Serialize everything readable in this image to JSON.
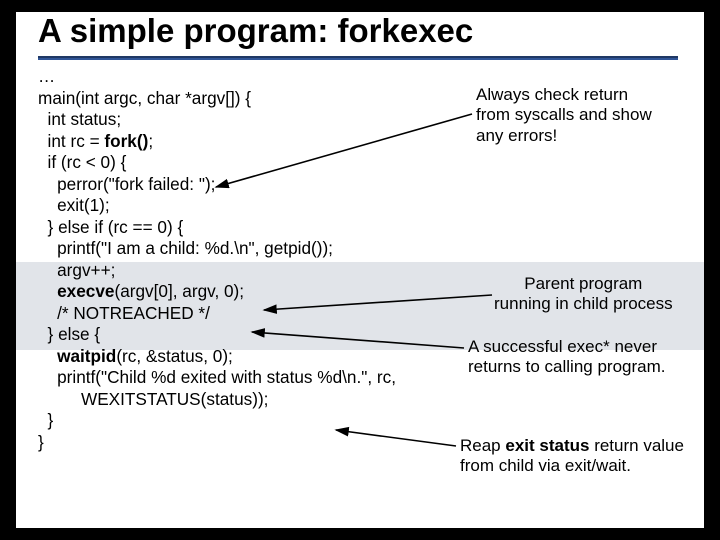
{
  "title": "A simple program: forkexec",
  "code": {
    "l0": "…",
    "l1a": "main(int argc, char *argv[]) {",
    "l2": "  int status;",
    "l3a": "  int rc = ",
    "l3b": "fork()",
    "l3c": ";",
    "l4": "  if (rc < 0) {",
    "l5": "    perror(\"fork failed: \");",
    "l6": "    exit(1);",
    "l7": "  } else if (rc == 0) {",
    "l8": "    printf(\"I am a child: %d.\\n\", getpid());",
    "l9": "    argv++;",
    "l10a": "    ",
    "l10b": "execve",
    "l10c": "(argv[0], argv, 0);",
    "l11": "    /* NOTREACHED */",
    "l12": "  } else {",
    "l13a": "    ",
    "l13b": "waitpid",
    "l13c": "(rc, &status, 0);",
    "l14": "    printf(\"Child %d exited with status %d\\n.\", rc,",
    "l15": "         WEXITSTATUS(status));",
    "l16": "  }",
    "l17": "}"
  },
  "annot": {
    "check1": "Always check return",
    "check2": "from syscalls and show",
    "check3": "any errors!",
    "parent1": "Parent program",
    "parent2": "running in child process",
    "exec1": "A successful exec* never",
    "exec2": "returns to calling program.",
    "reap1a": "Reap ",
    "reap1b": "exit status",
    "reap1c": " return value",
    "reap2": "from child via exit/wait."
  }
}
